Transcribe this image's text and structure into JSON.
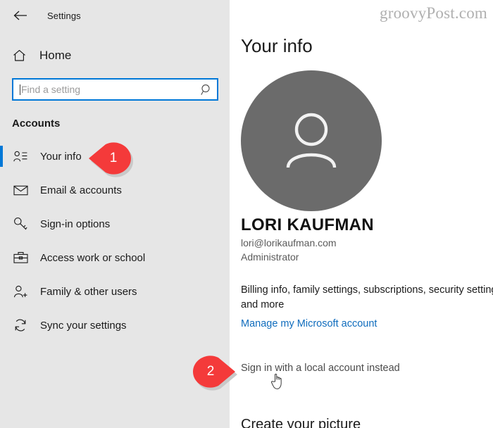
{
  "window": {
    "title": "Settings",
    "back_icon": "back-arrow-icon"
  },
  "sidebar": {
    "home": {
      "label": "Home",
      "icon": "home-icon"
    },
    "search": {
      "value": "",
      "placeholder": "Find a setting",
      "icon": "search-icon"
    },
    "section_header": "Accounts",
    "items": [
      {
        "label": "Your info",
        "icon": "contact-card-icon",
        "selected": true
      },
      {
        "label": "Email & accounts",
        "icon": "envelope-icon",
        "selected": false
      },
      {
        "label": "Sign-in options",
        "icon": "key-icon",
        "selected": false
      },
      {
        "label": "Access work or school",
        "icon": "briefcase-icon",
        "selected": false
      },
      {
        "label": "Family & other users",
        "icon": "person-plus-icon",
        "selected": false
      },
      {
        "label": "Sync your settings",
        "icon": "sync-icon",
        "selected": false
      }
    ]
  },
  "main": {
    "watermark": "groovyPost.com",
    "page_title": "Your info",
    "avatar_icon": "person-avatar-icon",
    "user_name": "LORI KAUFMAN",
    "user_email": "lori@lorikaufman.com",
    "user_role": "Administrator",
    "billing_text": "Billing info, family settings, subscriptions, security settings, and more",
    "manage_link": "Manage my Microsoft account",
    "local_account_link": "Sign in with a local account instead",
    "create_picture_title": "Create your picture"
  },
  "callouts": [
    {
      "number": "1",
      "direction": "left"
    },
    {
      "number": "2",
      "direction": "right"
    }
  ],
  "cursor": {
    "icon": "hand-pointer-cursor"
  },
  "colors": {
    "accent": "#0078d7",
    "sidebar_bg": "#e6e6e6",
    "link": "#0f6cbd",
    "callout_red": "#f43a3a",
    "avatar_gray": "#6b6b6b"
  }
}
